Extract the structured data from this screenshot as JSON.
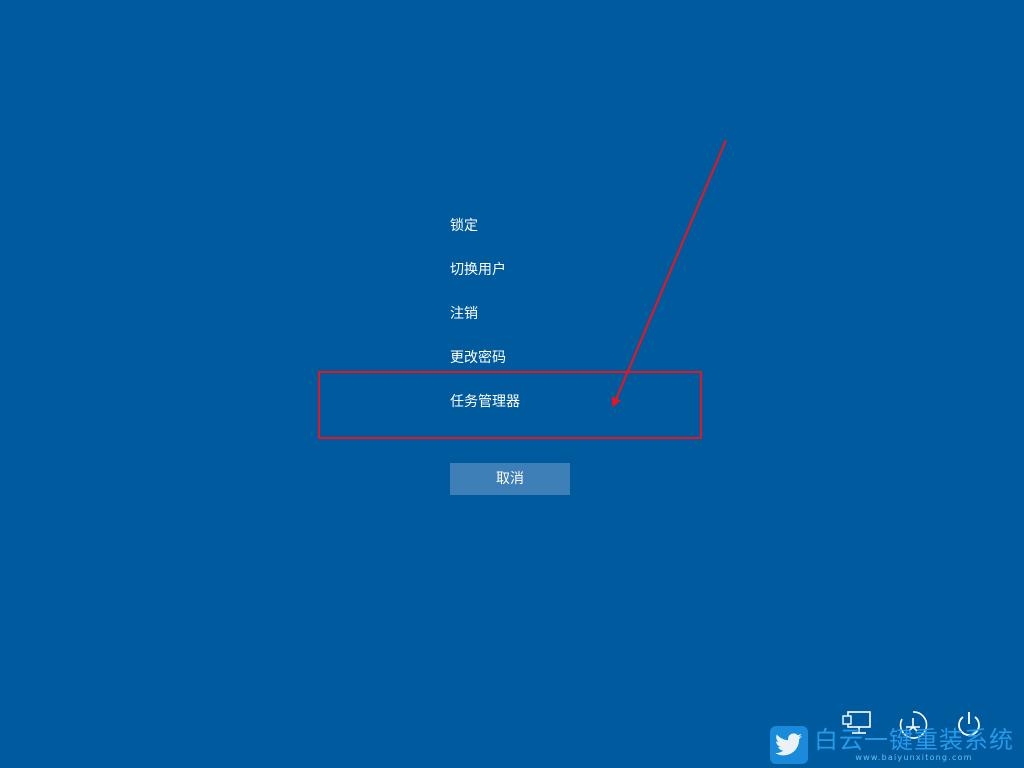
{
  "menu": {
    "items": [
      {
        "label": "锁定"
      },
      {
        "label": "切换用户"
      },
      {
        "label": "注销"
      },
      {
        "label": "更改密码"
      },
      {
        "label": "任务管理器"
      }
    ]
  },
  "cancel": {
    "label": "取消"
  },
  "annotation": {
    "highlighted_item": "任务管理器",
    "color": "#e4161e"
  },
  "bottom_icons": [
    "network-icon",
    "accessibility-icon",
    "power-icon"
  ],
  "watermark": {
    "text_cn": "白云一键重装系统",
    "text_en": "www.baiyunxitong.com",
    "icon": "twitter-bird-icon"
  },
  "colors": {
    "background": "#005a9e",
    "button": "#3e7fb7",
    "text": "#ffffff"
  }
}
